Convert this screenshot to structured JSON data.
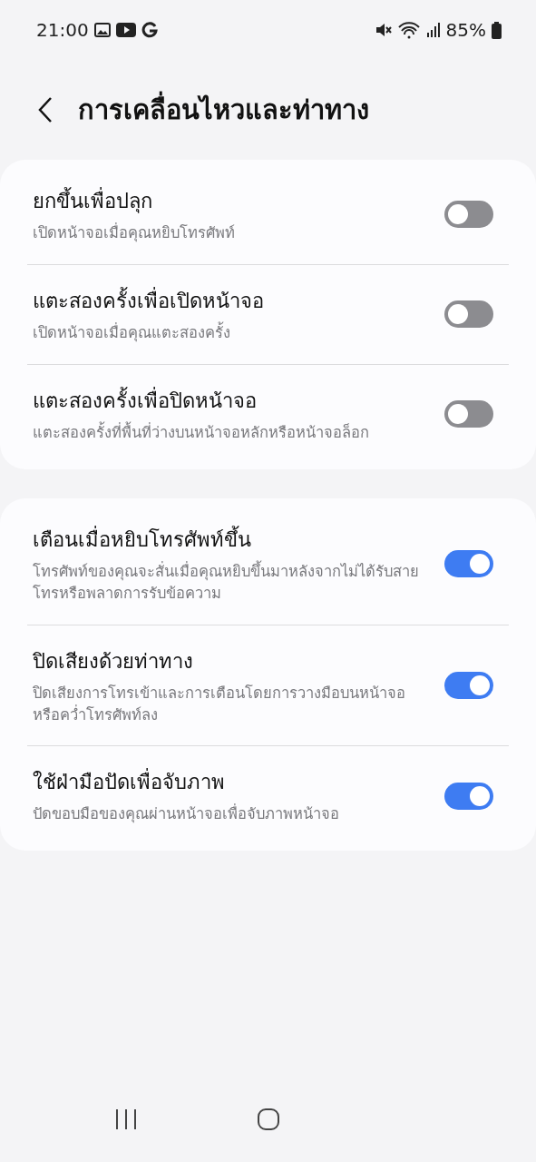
{
  "status_bar": {
    "time": "21:00",
    "battery": "85%"
  },
  "header": {
    "title": "การเคลื่อนไหวและท่าทาง"
  },
  "groups": [
    {
      "items": [
        {
          "title": "ยกขึ้นเพื่อปลุก",
          "subtitle": "เปิดหน้าจอเมื่อคุณหยิบโทรศัพท์",
          "on": false
        },
        {
          "title": "แตะสองครั้งเพื่อเปิดหน้าจอ",
          "subtitle": "เปิดหน้าจอเมื่อคุณแตะสองครั้ง",
          "on": false
        },
        {
          "title": "แตะสองครั้งเพื่อปิดหน้าจอ",
          "subtitle": "แตะสองครั้งที่พื้นที่ว่างบนหน้าจอหลักหรือหน้าจอล็อก",
          "on": false
        }
      ]
    },
    {
      "items": [
        {
          "title": "เตือนเมื่อหยิบโทรศัพท์ขึ้น",
          "subtitle": "โทรศัพท์ของคุณจะสั่นเมื่อคุณหยิบขึ้นมาหลังจากไม่ได้รับสายโทรหรือพลาดการรับข้อความ",
          "on": true
        },
        {
          "title": "ปิดเสียงด้วยท่าทาง",
          "subtitle": "ปิดเสียงการโทรเข้าและการเตือนโดยการวางมือบนหน้าจอ หรือคว่ำโทรศัพท์ลง",
          "on": true
        },
        {
          "title": "ใช้ฝ่ามือปัดเพื่อจับภาพ",
          "subtitle": "ปัดขอบมือของคุณผ่านหน้าจอเพื่อจับภาพหน้าจอ",
          "on": true
        }
      ]
    }
  ]
}
